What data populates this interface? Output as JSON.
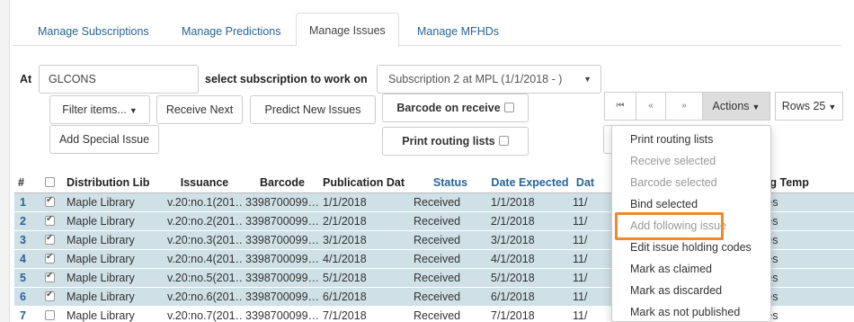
{
  "tabs": [
    {
      "label": "Manage Subscriptions"
    },
    {
      "label": "Manage Predictions"
    },
    {
      "label": "Manage Issues"
    },
    {
      "label": "Manage MFHDs"
    }
  ],
  "toolbar": {
    "at_label": "At",
    "location_value": "GLCONS",
    "select_sub_label": "select subscription to work on",
    "subscription_value": "Subscription 2 at MPL (1/1/2018 - )",
    "filter_label": "Filter items...",
    "receive_next_label": "Receive Next",
    "predict_label": "Predict New Issues",
    "barcode_receive_label": "Barcode on receive",
    "print_routing_label": "Print routing lists",
    "add_special_label": "Add Special Issue"
  },
  "pager": {
    "first": "⏮",
    "prev": "«",
    "next": "»",
    "actions_label": "Actions",
    "rows_label": "Rows 25"
  },
  "menu": {
    "items": [
      {
        "label": "Print routing lists",
        "enabled": true
      },
      {
        "label": "Receive selected",
        "enabled": false
      },
      {
        "label": "Barcode selected",
        "enabled": false
      },
      {
        "label": "Bind selected",
        "enabled": true
      },
      {
        "label": "Add following issue",
        "enabled": false
      },
      {
        "label": "Edit issue holding codes",
        "enabled": true
      },
      {
        "label": "Mark as claimed",
        "enabled": true
      },
      {
        "label": "Mark as discarded",
        "enabled": true
      },
      {
        "label": "Mark as not published",
        "enabled": true
      }
    ]
  },
  "table": {
    "headers": [
      "#",
      "",
      "Distribution Lib",
      "Issuance",
      "Barcode",
      "Publication Dat",
      "Status",
      "Date Expected",
      "Dat",
      "",
      "Receiving Temp"
    ],
    "rows": [
      {
        "num": "1",
        "checked": true,
        "lib": "Maple Library",
        "issuance": "v.20:no.1(201…",
        "barcode": "3398700099…",
        "pub": "1/1/2018",
        "status": "Received",
        "expected": "1/1/2018",
        "dat": "11/",
        "template": "Magazines"
      },
      {
        "num": "2",
        "checked": true,
        "lib": "Maple Library",
        "issuance": "v.20:no.2(201…",
        "barcode": "3398700099…",
        "pub": "2/1/2018",
        "status": "Received",
        "expected": "2/1/2018",
        "dat": "11/",
        "template": "Magazines"
      },
      {
        "num": "3",
        "checked": true,
        "lib": "Maple Library",
        "issuance": "v.20:no.3(201…",
        "barcode": "3398700099…",
        "pub": "3/1/2018",
        "status": "Received",
        "expected": "3/1/2018",
        "dat": "11/",
        "template": "Magazines"
      },
      {
        "num": "4",
        "checked": true,
        "lib": "Maple Library",
        "issuance": "v.20:no.4(201…",
        "barcode": "3398700099…",
        "pub": "4/1/2018",
        "status": "Received",
        "expected": "4/1/2018",
        "dat": "11/",
        "template": "Magazines"
      },
      {
        "num": "5",
        "checked": true,
        "lib": "Maple Library",
        "issuance": "v.20:no.5(201…",
        "barcode": "3398700099…",
        "pub": "5/1/2018",
        "status": "Received",
        "expected": "5/1/2018",
        "dat": "11/",
        "template": "Magazines"
      },
      {
        "num": "6",
        "checked": true,
        "lib": "Maple Library",
        "issuance": "v.20:no.6(201…",
        "barcode": "3398700099…",
        "pub": "6/1/2018",
        "status": "Received",
        "expected": "6/1/2018",
        "dat": "11/",
        "template": "Magazines"
      },
      {
        "num": "7",
        "checked": false,
        "lib": "Maple Library",
        "issuance": "v.20:no.7(201…",
        "barcode": "3398700099…",
        "pub": "7/1/2018",
        "status": "Received",
        "expected": "7/1/2018",
        "dat": "11/",
        "template": "Magazines"
      }
    ]
  },
  "colors": {
    "link": "#2a6496",
    "selected_row": "#cfe0e6",
    "highlight": "#f0892a"
  }
}
